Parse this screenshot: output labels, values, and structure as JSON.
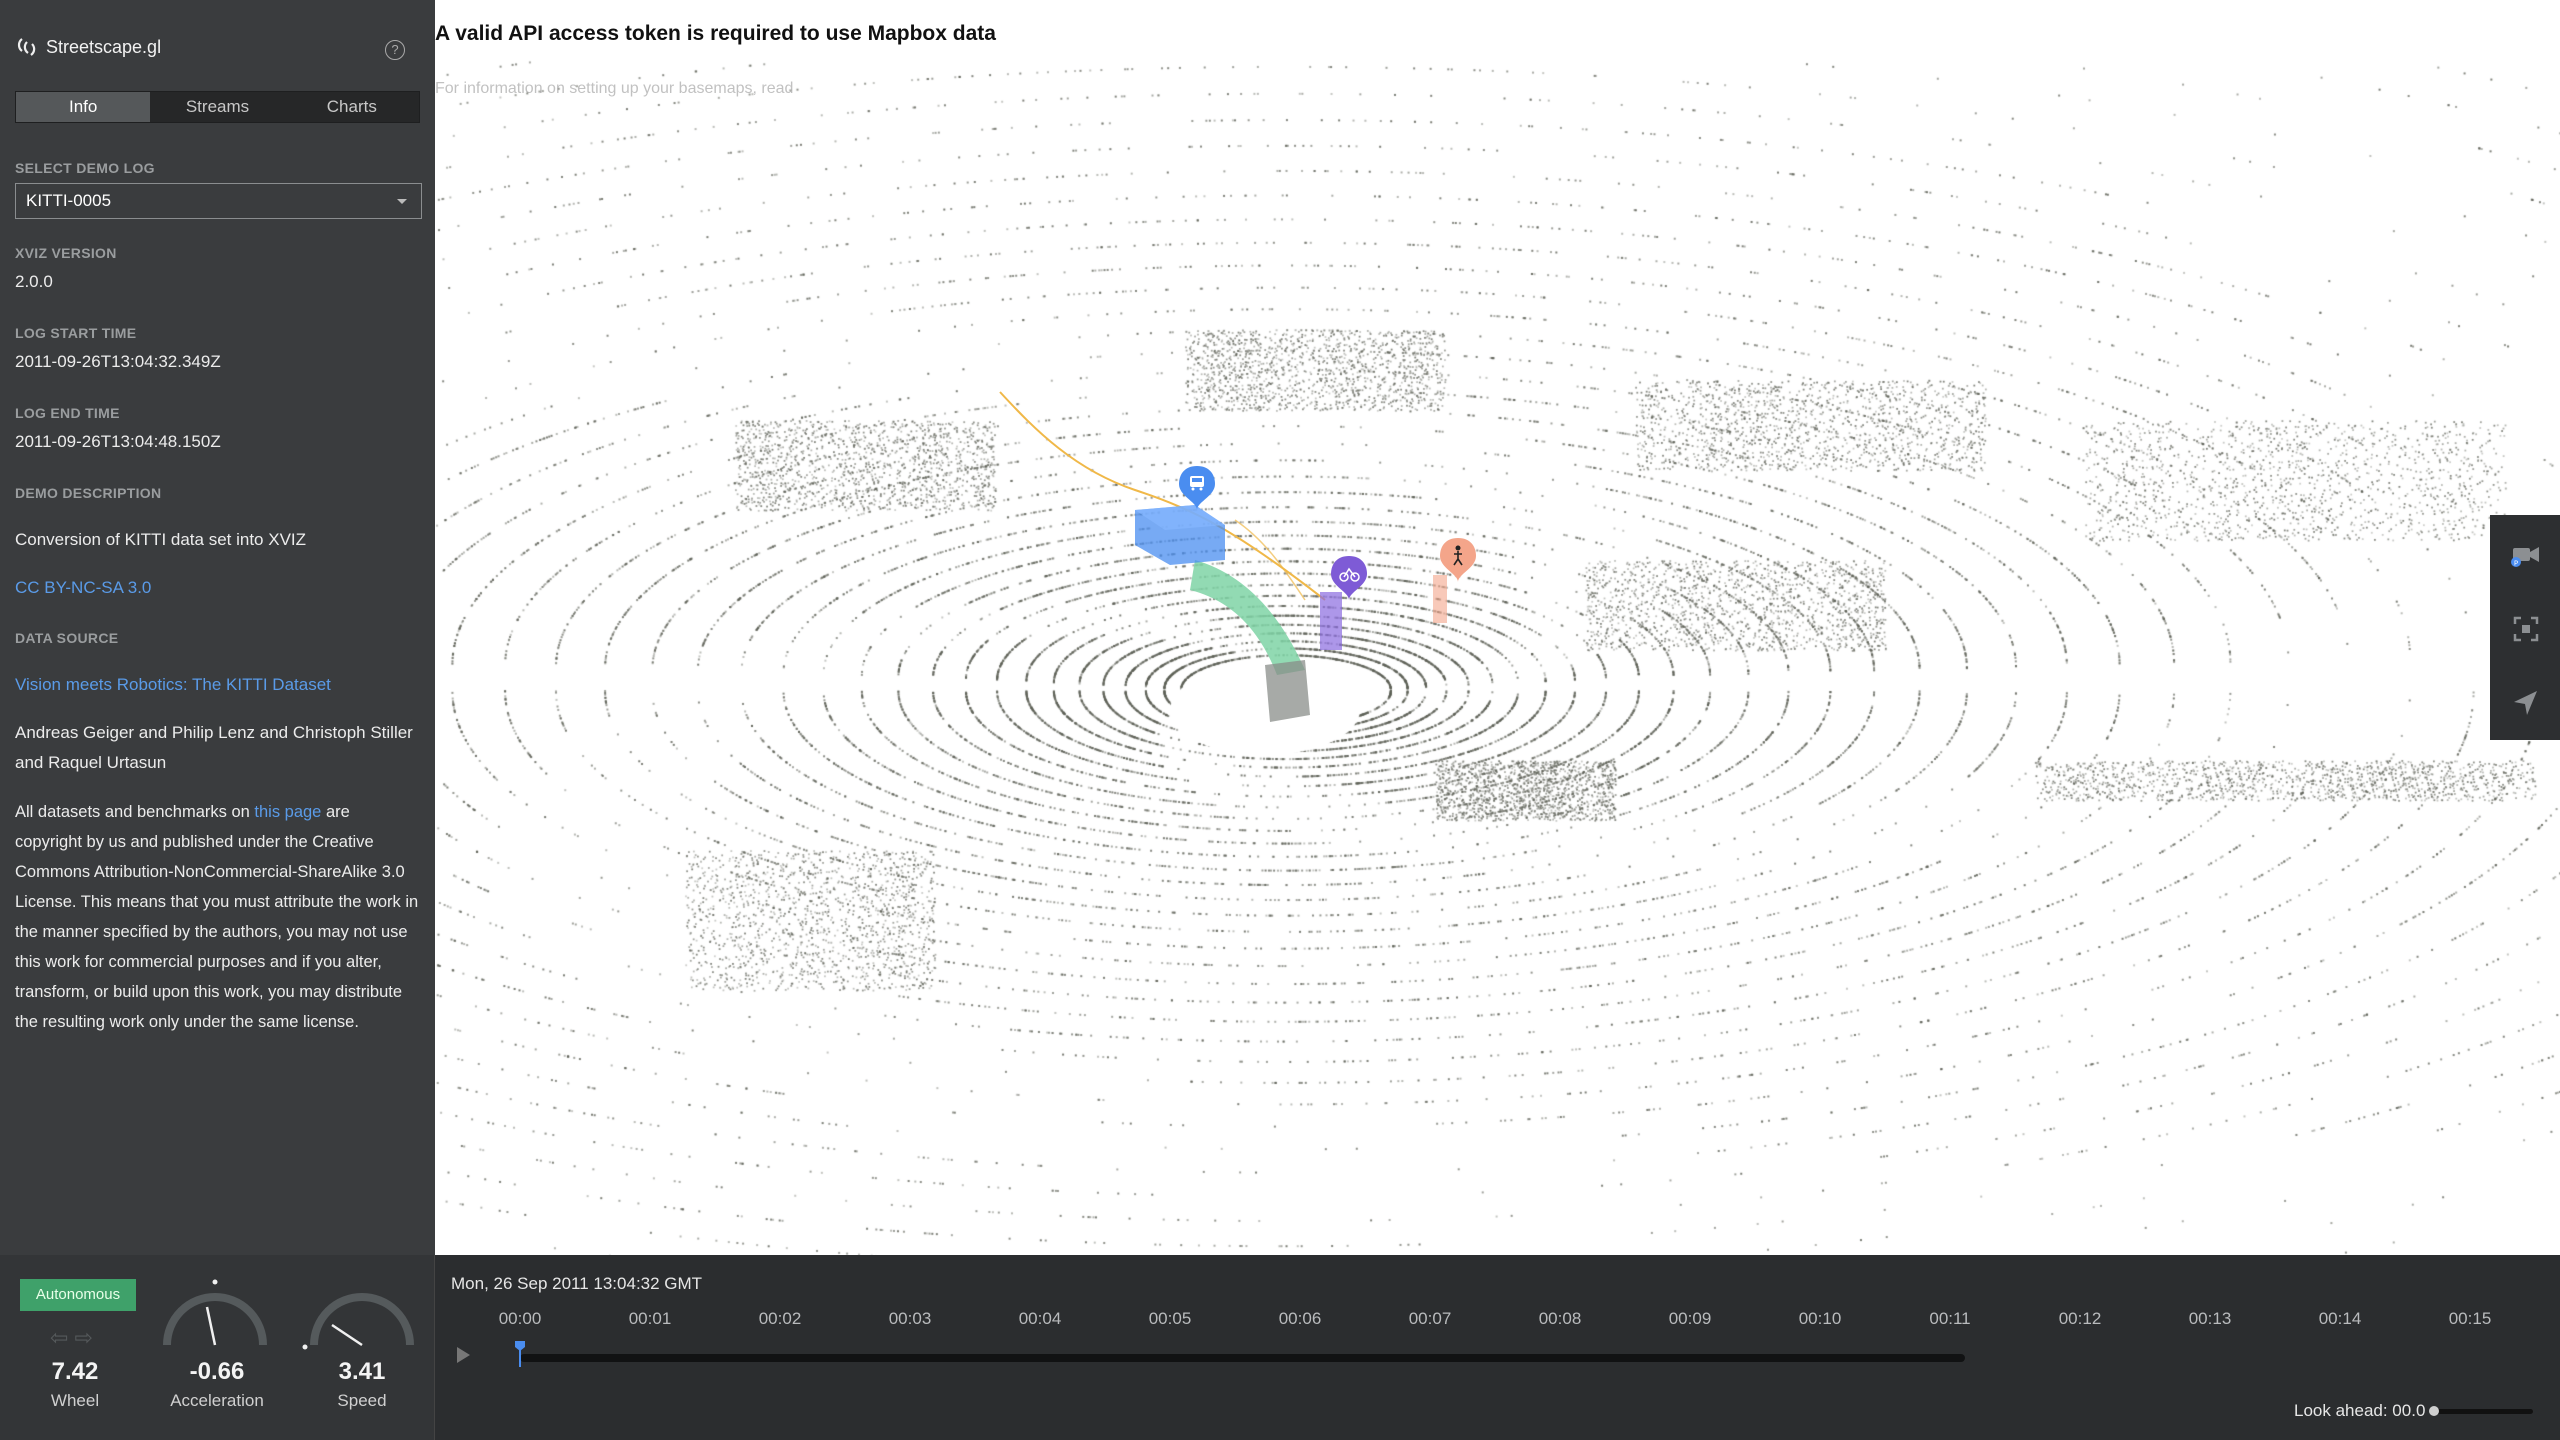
{
  "viewport": {
    "mapbox_warning": "A valid API access token is required to use Mapbox data",
    "mapbox_warning_sub": "For information on setting up your basemaps, read"
  },
  "panel": {
    "brand": "Streetscape.gl",
    "help_icon": "help-circle-icon",
    "tabs": [
      {
        "label": "Info",
        "active": true
      },
      {
        "label": "Streams",
        "active": false
      },
      {
        "label": "Charts",
        "active": false
      }
    ],
    "demo_log_label": "SELECT DEMO LOG",
    "demo_log_value": "KITTI-0005",
    "xviz_version_label": "XVIZ VERSION",
    "xviz_version_value": "2.0.0",
    "log_start_label": "LOG START TIME",
    "log_start_value": "2011-09-26T13:04:32.349Z",
    "log_end_label": "LOG END TIME",
    "log_end_value": "2011-09-26T13:04:48.150Z",
    "description_label": "DEMO DESCRIPTION",
    "description_value": "Conversion of KITTI data set into XVIZ",
    "license_link": "CC BY-NC-SA 3.0",
    "data_source_label": "DATA SOURCE",
    "data_source_link": "Vision meets Robotics: The KITTI Dataset",
    "authors": "Andreas Geiger and Philip Lenz and Christoph Stiller and Raquel Urtasun",
    "copyright_prefix": "All datasets and benchmarks on ",
    "copyright_link": "this page",
    "copyright_suffix": " are copyright by us and published under the Creative Commons Attribution-NonCommercial-ShareAlike 3.0 License. This means that you must attribute the work in the manner specified by the authors, you may not use this work for commercial purposes and if you alter, transform, or build upon this work, you may distribute the resulting work only under the same license."
  },
  "toolbar": {
    "items": [
      "camera-icon",
      "fullscreen-icon",
      "locate-icon"
    ]
  },
  "hud": {
    "mode": "Autonomous",
    "wheel_value": "7.42",
    "wheel_label": "Wheel",
    "acceleration_value": "-0.66",
    "acceleration_label": "Acceleration",
    "speed_value": "3.41",
    "speed_label": "Speed"
  },
  "timeline": {
    "date": "Mon, 26 Sep 2011 13:04:32 GMT",
    "ticks": [
      "00:00",
      "00:01",
      "00:02",
      "00:03",
      "00:04",
      "00:05",
      "00:06",
      "00:07",
      "00:08",
      "00:09",
      "00:10",
      "00:11",
      "00:12",
      "00:13",
      "00:14",
      "00:15"
    ],
    "lookahead_label": "Look ahead: 00.0",
    "progress": 0.0
  },
  "colors": {
    "panel_bg": "#3a3c3e",
    "link": "#5a9be8",
    "autonomous": "#3fa16a",
    "trajectory": "#7fd3a6",
    "bus": "#4a8df0",
    "cyclist": "#7e5bd6",
    "pedestrian": "#f4a58a",
    "path_line": "#f0b848"
  }
}
